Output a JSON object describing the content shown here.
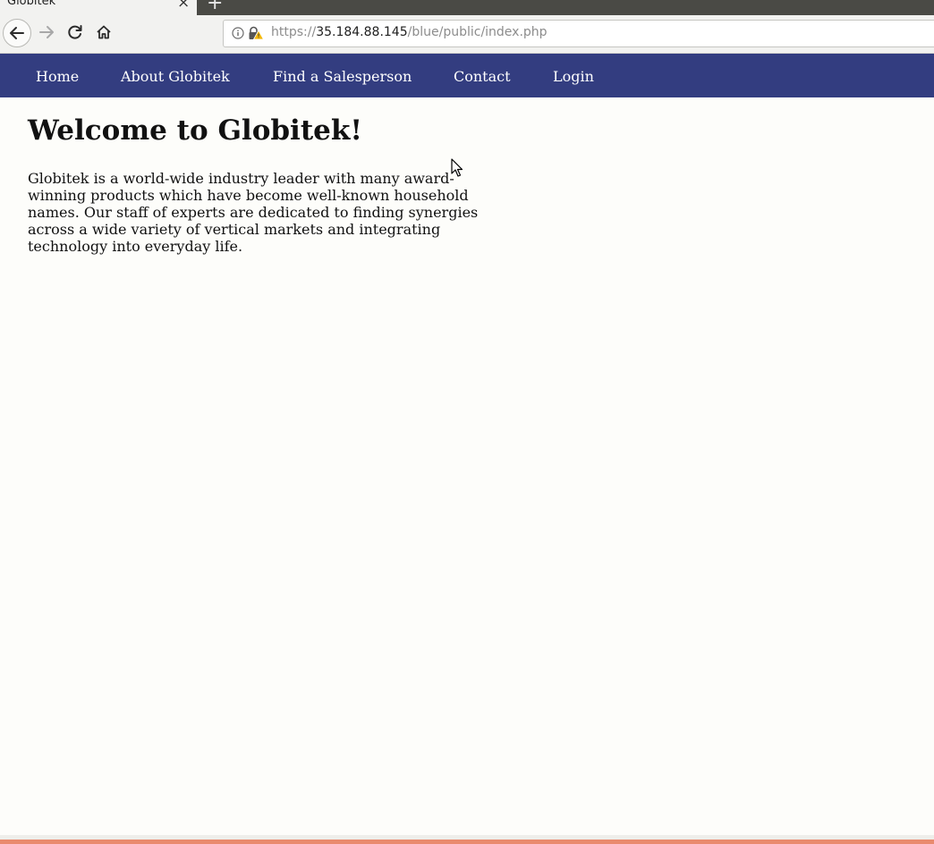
{
  "browser": {
    "tab_title": "Globitek",
    "tab_close": "×",
    "new_tab": "+",
    "url_scheme": "https://",
    "url_host": "35.184.88.145",
    "url_path": "/blue/public/index.php",
    "buttons": {
      "back": "back-arrow-icon",
      "forward": "forward-arrow-icon",
      "reload": "reload-icon",
      "home": "home-icon"
    }
  },
  "nav": {
    "items": [
      {
        "label": "Home"
      },
      {
        "label": "About Globitek"
      },
      {
        "label": "Find a Salesperson"
      },
      {
        "label": "Contact"
      },
      {
        "label": "Login"
      }
    ]
  },
  "main": {
    "title": "Welcome to Globitek!",
    "intro": "Globitek is a world-wide industry leader with many award-winning products which have become well-known household names. Our staff of experts are dedicated to finding synergies across a wide variety of vertical markets and integrating technology into everyday life."
  },
  "colors": {
    "nav_background": "#333d80",
    "page_background": "#fdfdfa",
    "footer_stripe": "#e98a6e"
  }
}
